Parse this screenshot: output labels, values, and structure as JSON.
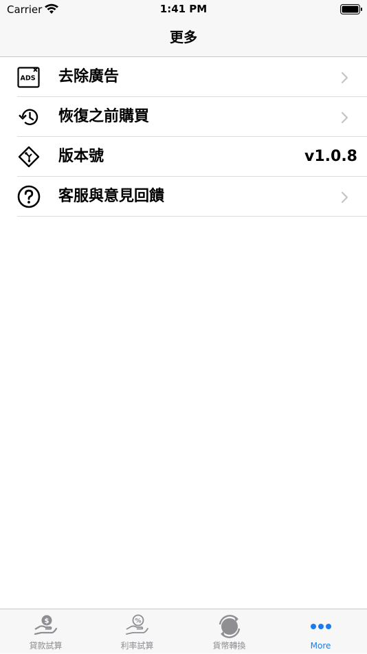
{
  "status_bar": {
    "carrier": "Carrier",
    "time": "1:41 PM"
  },
  "nav": {
    "title": "更多"
  },
  "menu": {
    "items": [
      {
        "label": "去除廣告",
        "icon": "ads-icon"
      },
      {
        "label": "恢復之前購買",
        "icon": "history-icon"
      },
      {
        "label": "版本號",
        "icon": "version-icon",
        "value": "v1.0.8"
      },
      {
        "label": "客服與意見回饋",
        "icon": "help-icon"
      }
    ]
  },
  "tabs": [
    {
      "label": "貸款試算",
      "icon": "loan-icon",
      "active": false
    },
    {
      "label": "利率試算",
      "icon": "interest-rate-icon",
      "active": false
    },
    {
      "label": "貨幣轉換",
      "icon": "currency-exchange-icon",
      "active": false
    },
    {
      "label": "More",
      "icon": "more-icon",
      "active": true
    }
  ],
  "colors": {
    "accent": "#1a7bf0",
    "inactive_tab": "#8e8e93",
    "bar_background": "#f7f7f7",
    "separator": "#dcdcdf"
  }
}
